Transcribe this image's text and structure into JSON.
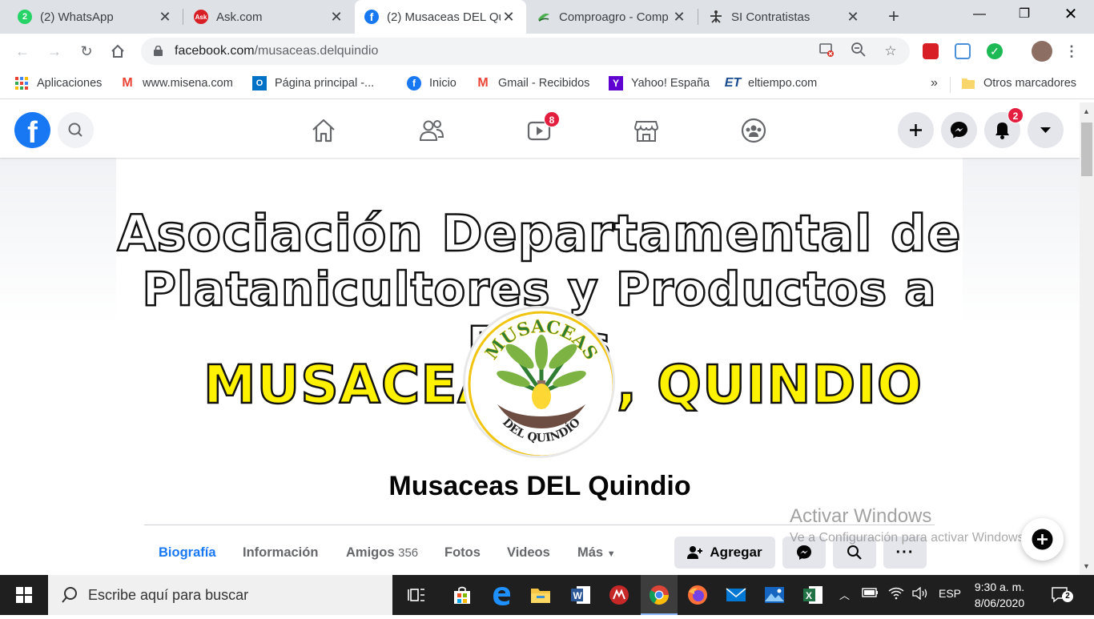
{
  "tabs": [
    {
      "label": "(2) WhatsApp",
      "icon": "whatsapp-icon",
      "color": "#25d366",
      "glyph": "2"
    },
    {
      "label": "Ask.com",
      "icon": "ask-icon",
      "color": "#d91f26",
      "glyph": "Ask"
    },
    {
      "label": "(2) Musaceas DEL Qu",
      "icon": "facebook-icon",
      "color": "#1877f2",
      "glyph": "f"
    },
    {
      "label": "Comproagro - Comp",
      "icon": "comproagro-icon",
      "color": "#2e8b57",
      "glyph": ""
    },
    {
      "label": "SI Contratistas",
      "icon": "sena-icon",
      "color": "#333333",
      "glyph": ""
    }
  ],
  "address_bar": {
    "domain": "facebook.com",
    "path": "/musaceas.delquindio"
  },
  "bookmarks": [
    {
      "label": "Aplicaciones",
      "icon": "apps-grid-icon"
    },
    {
      "label": "www.misena.com",
      "icon": "gmail-icon"
    },
    {
      "label": "Página principal -...",
      "icon": "outlook-icon"
    },
    {
      "label": "Inicio",
      "icon": "facebook-icon"
    },
    {
      "label": "Gmail - Recibidos",
      "icon": "gmail-icon"
    },
    {
      "label": "Yahoo! España",
      "icon": "yahoo-icon"
    },
    {
      "label": "eltiempo.com",
      "icon": "eltiempo-icon"
    },
    {
      "label": "»",
      "icon": "chevron-more-icon"
    },
    {
      "label": "Otros marcadores",
      "icon": "folder-icon"
    }
  ],
  "facebook": {
    "watch_badge": "8",
    "notifications_badge": "2",
    "cover": {
      "line1": "Asociación Departamental de",
      "line2": "Platanicultores y Productos a Fines",
      "brand_left": "MUSACEA",
      "brand_right": ", QUINDIO",
      "logo_top": "MUSACEAS",
      "logo_bottom": "DEL QUINDÍO"
    },
    "page_name": "Musaceas DEL Quindio",
    "profile_tabs": [
      {
        "label": "Biografía",
        "active": true
      },
      {
        "label": "Información"
      },
      {
        "label": "Amigos",
        "count": "356"
      },
      {
        "label": "Fotos"
      },
      {
        "label": "Videos"
      },
      {
        "label": "Más"
      }
    ],
    "add_friend_label": "Agregar"
  },
  "windows_watermark": {
    "line1": "Activar Windows",
    "line2": "Ve a Configuración para activar Windows."
  },
  "taskbar": {
    "search_placeholder": "Escribe aquí para buscar",
    "language": "ESP",
    "time": "9:30 a. m.",
    "date": "8/06/2020",
    "notification_count": "2"
  },
  "colors": {
    "facebook_blue": "#1877f2",
    "badge_red": "#e41e3f",
    "brand_yellow": "#fff200"
  }
}
